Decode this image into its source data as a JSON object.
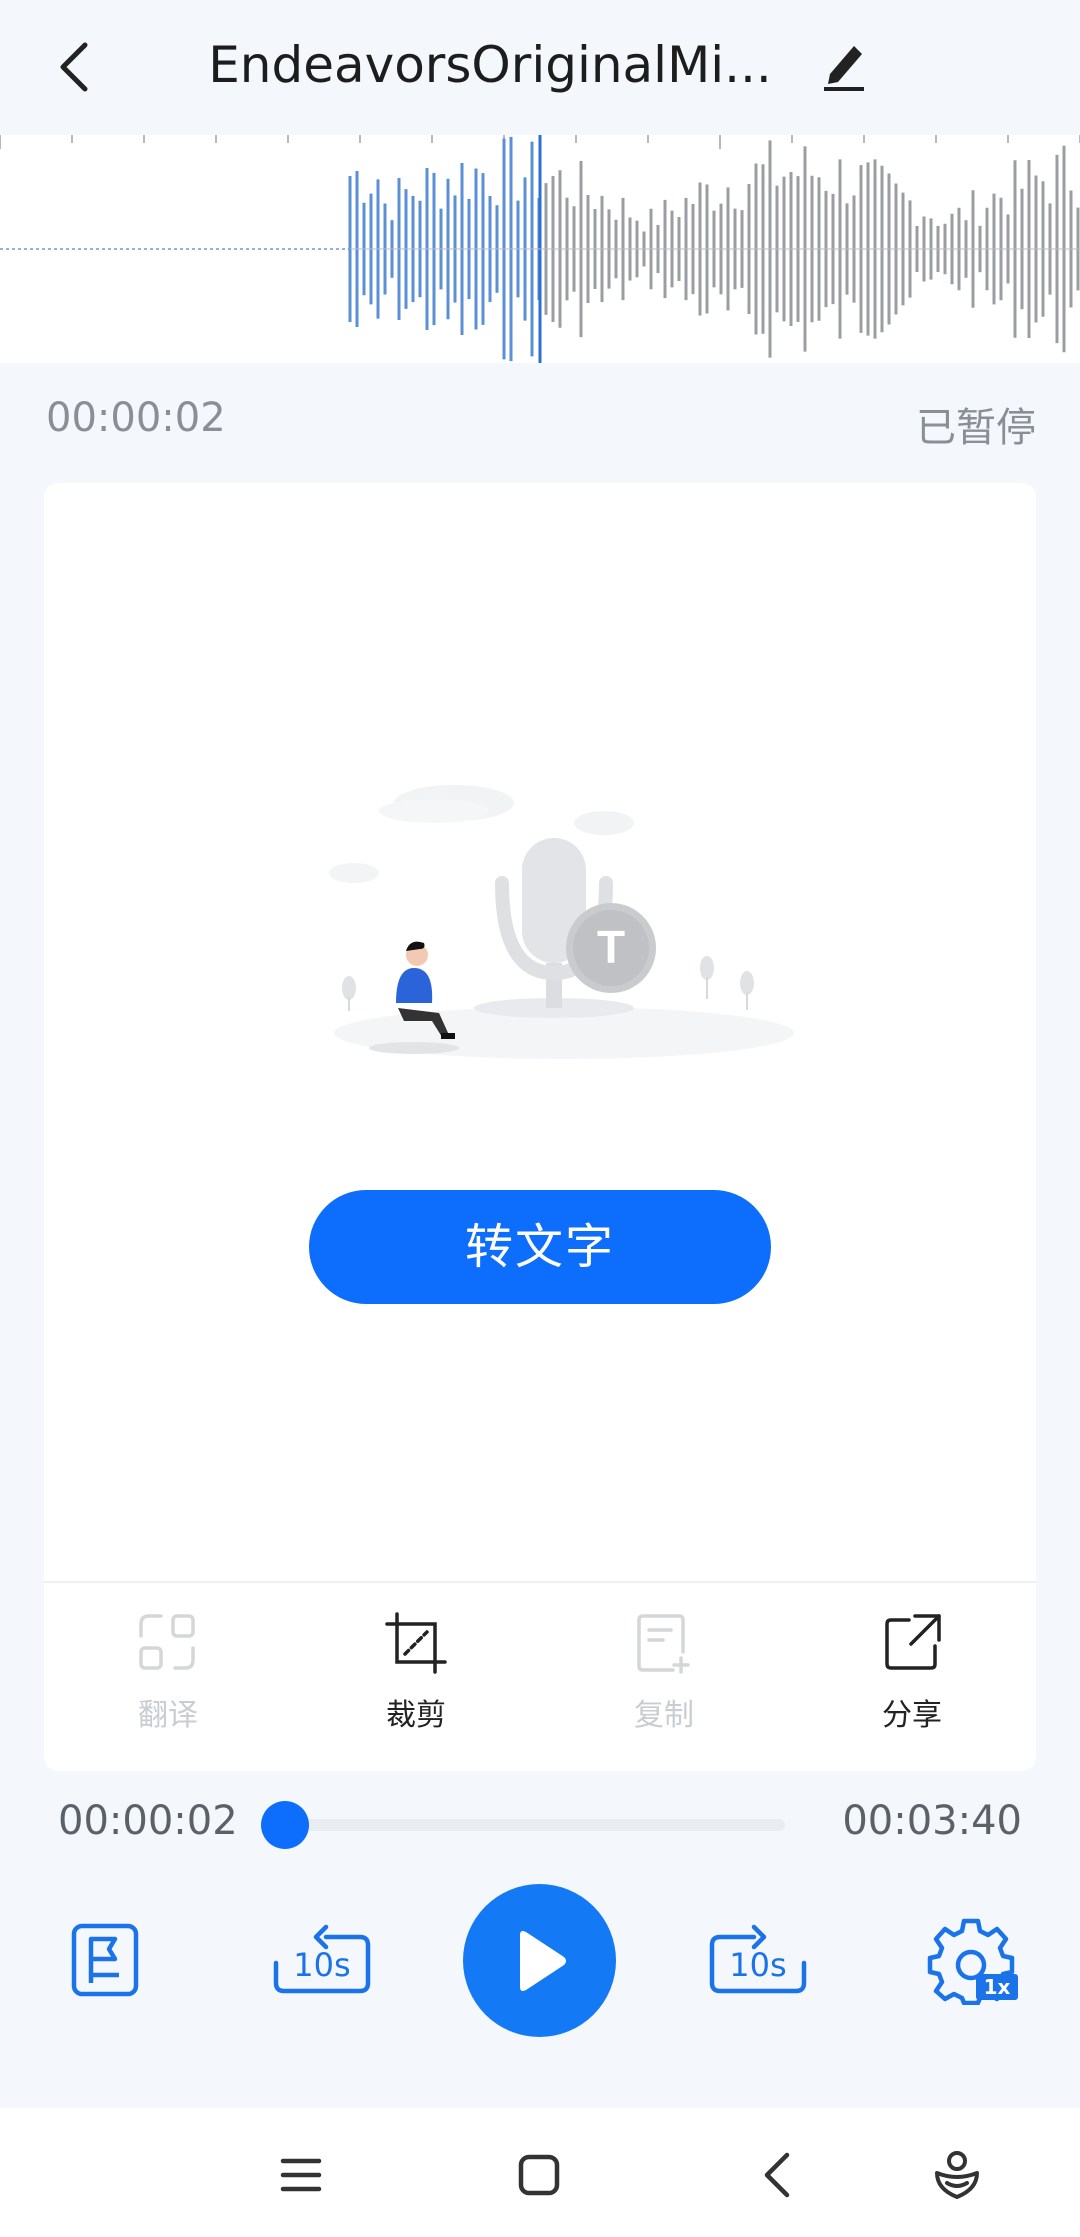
{
  "header": {
    "title": "EndeavorsOriginalMi...",
    "back_icon": "chevron-left-icon",
    "edit_icon": "pencil-icon"
  },
  "recording": {
    "current_time": "00:00:02",
    "status": "已暂停"
  },
  "transcribe": {
    "button_label": "转文字"
  },
  "actions": [
    {
      "label": "翻译",
      "icon": "translate-icon",
      "enabled": false
    },
    {
      "label": "裁剪",
      "icon": "crop-icon",
      "enabled": true
    },
    {
      "label": "复制",
      "icon": "copy-icon",
      "enabled": false
    },
    {
      "label": "分享",
      "icon": "share-icon",
      "enabled": true
    }
  ],
  "player": {
    "position": "00:00:02",
    "duration": "00:03:40",
    "progress_fraction": 0.009,
    "rewind_label": "10s",
    "forward_label": "10s",
    "speed_label": "1x"
  },
  "colors": {
    "accent": "#0d6efd",
    "played_wave": "#5b8fd6",
    "unplayed_wave": "#9a9da1"
  }
}
